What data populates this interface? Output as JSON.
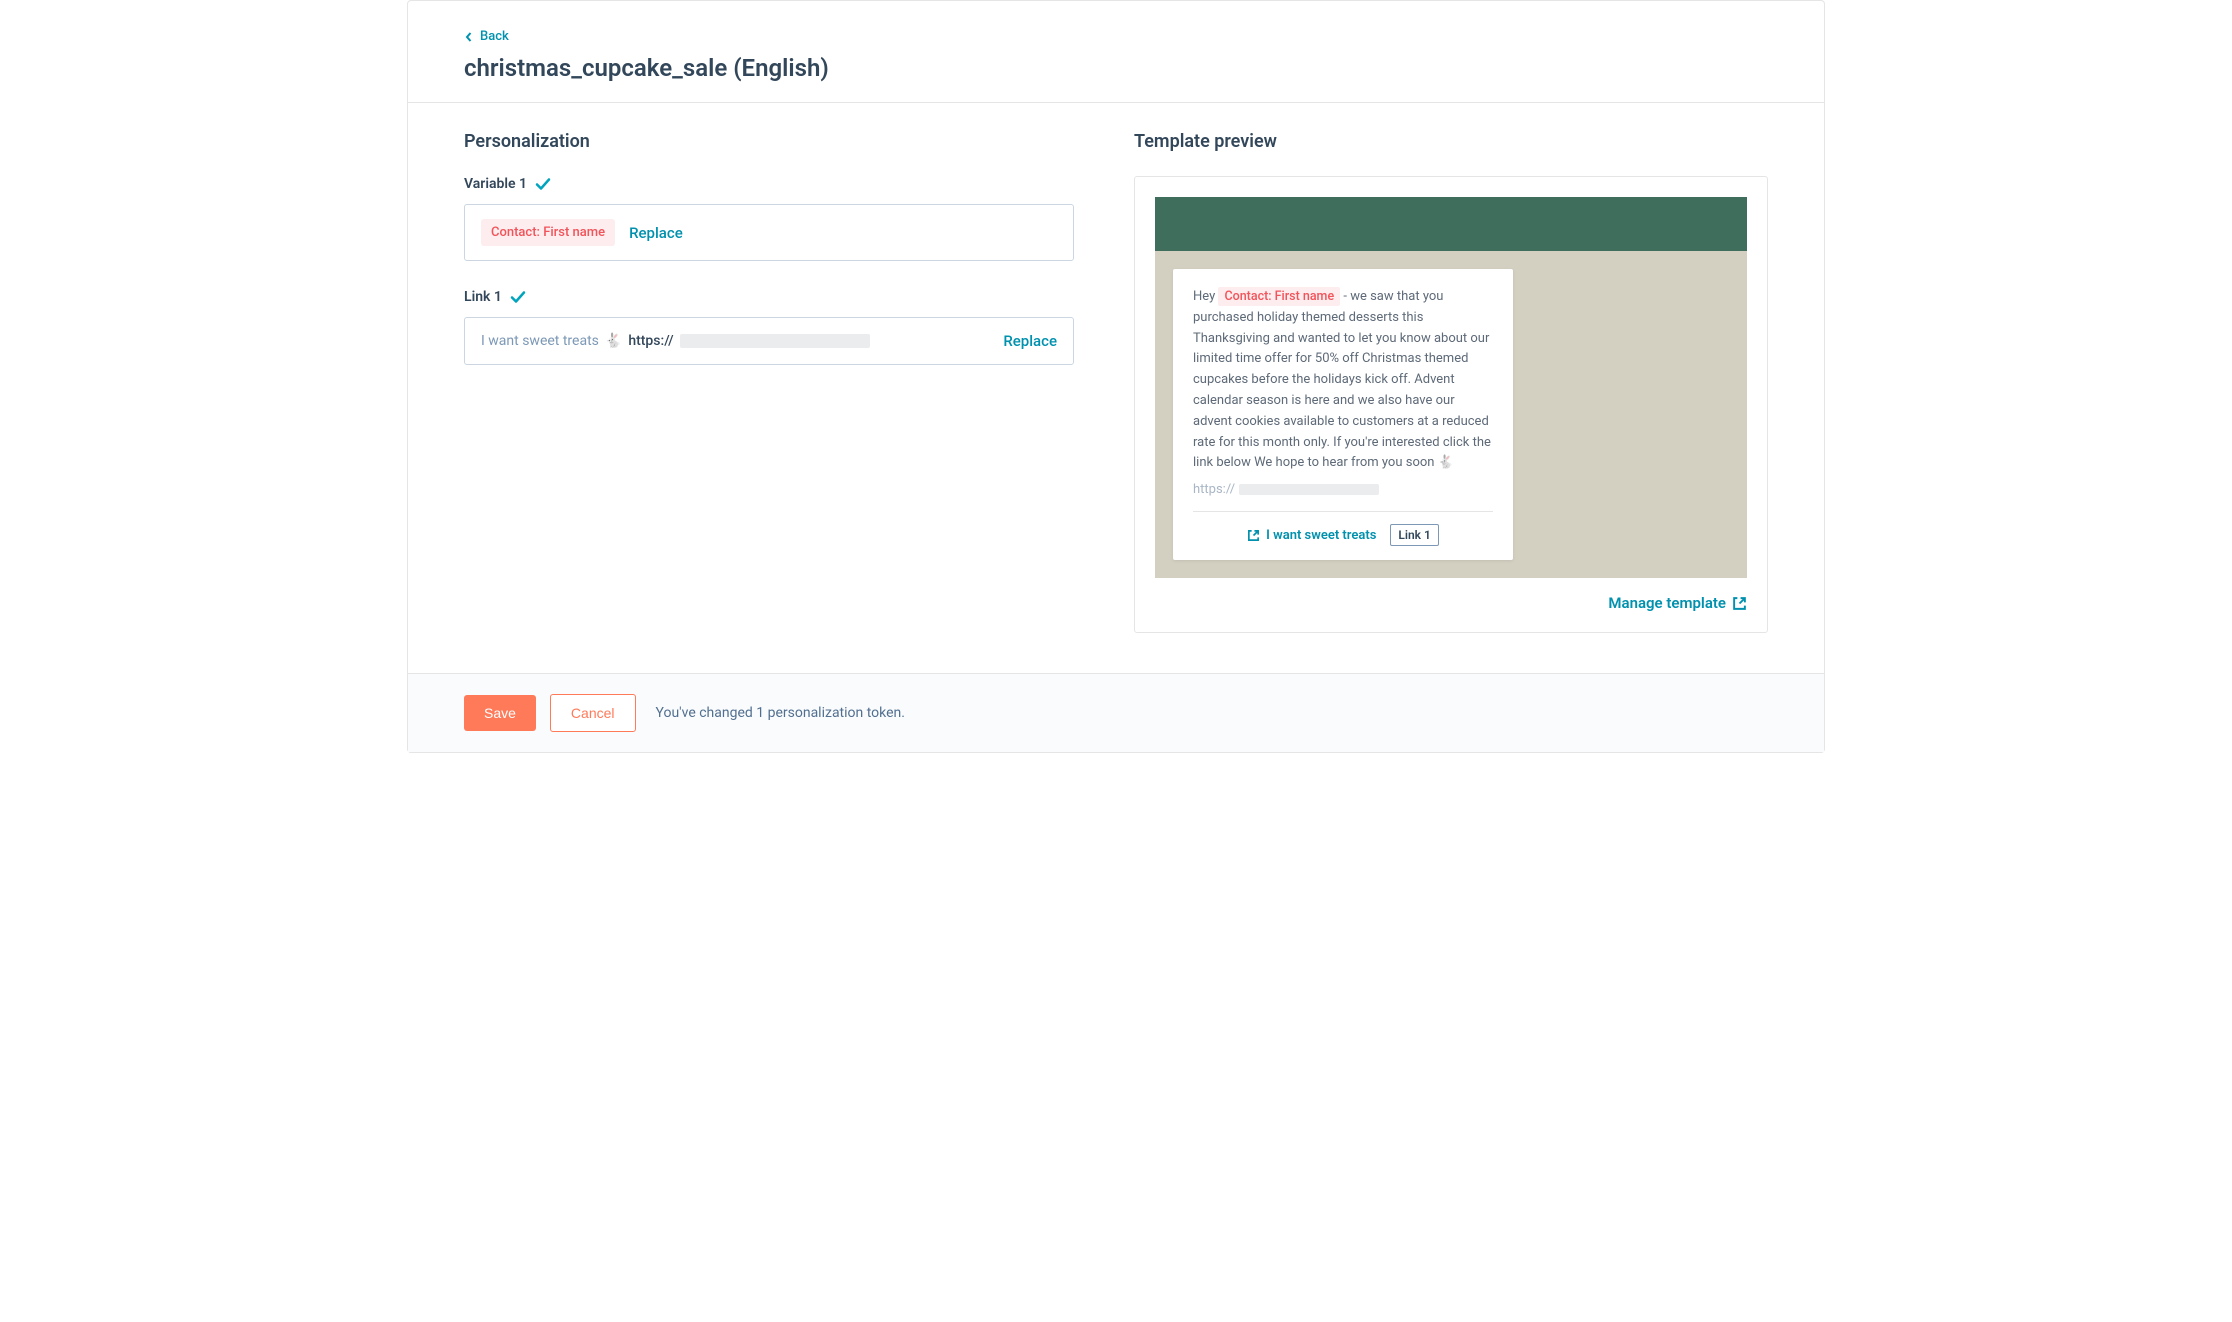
{
  "header": {
    "back_label": "Back",
    "page_title": "christmas_cupcake_sale (English)"
  },
  "personalization": {
    "heading": "Personalization",
    "variable1": {
      "label": "Variable 1",
      "token": "Contact: First name",
      "replace": "Replace"
    },
    "link1": {
      "label": "Link 1",
      "text": "I want sweet treats",
      "emoji": "🐇",
      "url_prefix": "https://",
      "replace": "Replace"
    }
  },
  "preview": {
    "heading": "Template preview",
    "body_before": "Hey ",
    "token": "Contact: First name",
    "body_after": " - we saw that you purchased holiday themed desserts this Thanksgiving and wanted to let you know about our limited time offer for 50% off Christmas themed cupcakes before the holidays kick off. Advent calendar season is here and we also have our advent cookies available to customers at a reduced rate for this month only. If you're interested click the link below We hope to hear from you soon 🐇",
    "url_prefix": "https://",
    "cta_text": "I want sweet treats",
    "badge": "Link 1",
    "manage_label": "Manage template"
  },
  "footer": {
    "save": "Save",
    "cancel": "Cancel",
    "message": "You've changed 1 personalization token."
  }
}
